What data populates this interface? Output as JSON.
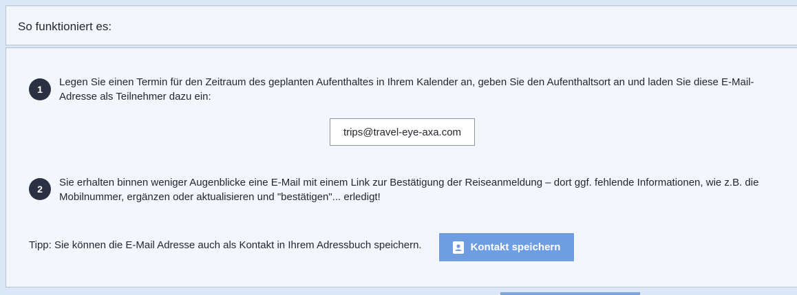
{
  "header": {
    "title": "So funktioniert es:"
  },
  "steps": [
    {
      "number": "1",
      "text": "Legen Sie einen Termin für den Zeitraum des geplanten Aufenthaltes in Ihrem Kalender an, geben Sie den Aufenthaltsort an und laden Sie diese E-Mail-Adresse als Teilnehmer dazu ein:"
    },
    {
      "number": "2",
      "text": "Sie erhalten binnen weniger Augenblicke eine E-Mail mit einem Link zur Bestätigung der Reiseanmeldung – dort ggf. fehlende Informationen, wie z.B. die Mobilnummer, ergänzen oder aktualisieren und \"bestätigen\"... erledigt!"
    }
  ],
  "email": {
    "value": "trips@travel-eye-axa.com"
  },
  "tip": {
    "text": "Tipp: Sie können die E-Mail Adresse auch als Kontakt in Ihrem Adressbuch speichern.",
    "button_label": "Kontakt speichern",
    "button_icon": "contact-card-icon"
  },
  "colors": {
    "background": "#dbe7f6",
    "panel": "#f3f7fc",
    "badge": "#2b3142",
    "button": "#6f9de2"
  }
}
